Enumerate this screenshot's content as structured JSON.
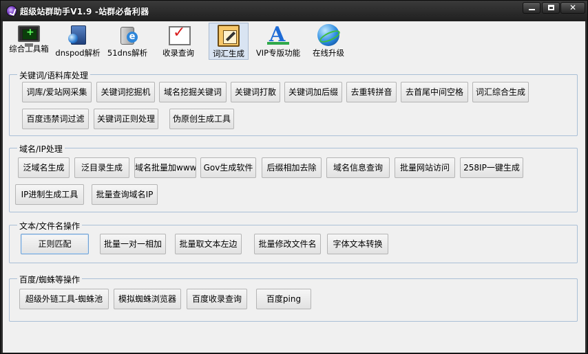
{
  "window": {
    "title": "超级站群助手V1.9 -站群必备利器",
    "close_symbol": "✕"
  },
  "toolbar": {
    "items": [
      {
        "label": "综合工具箱",
        "icon": "monitor-plus-icon"
      },
      {
        "label": "dnspod解析",
        "icon": "network-globe-icon"
      },
      {
        "label": "51dns解析",
        "icon": "server-ie-icon"
      },
      {
        "label": "收录查询",
        "icon": "checkmark-board-icon"
      },
      {
        "label": "词汇生成",
        "icon": "edit-notepad-icon"
      },
      {
        "label": "VIP专版功能",
        "icon": "font-a-icon"
      },
      {
        "label": "在线升级",
        "icon": "globe-icon"
      }
    ]
  },
  "groups": [
    {
      "title": "关键词/语料库处理",
      "buttons": [
        "词库/爱站网采集",
        "关键词挖掘机",
        "域名挖掘关键词",
        "关键词打散",
        "关键词加后缀",
        "去重转拼音",
        "去首尾中间空格",
        "词汇综合生成",
        "百度违禁词过滤",
        "关键词正则处理",
        "伪原创生成工具"
      ]
    },
    {
      "title": "域名/IP处理",
      "buttons": [
        "泛域名生成",
        "泛目录生成",
        "域名批量加www",
        "Gov生成软件",
        "后缀相加去除",
        "域名信息查询",
        "批量网站访问",
        "258IP一键生成",
        "IP进制生成工具",
        "批量查询域名IP"
      ]
    },
    {
      "title": "文本/文件名操作",
      "buttons": [
        "正则匹配",
        "批量一对一相加",
        "批量取文本左边",
        "批量修改文件名",
        "字体文本转换"
      ]
    },
    {
      "title": "百度/蜘蛛等操作",
      "buttons": [
        "超级外链工具-蜘蛛池",
        "模拟蜘蛛浏览器",
        "百度收录查询",
        "百度ping"
      ]
    }
  ]
}
